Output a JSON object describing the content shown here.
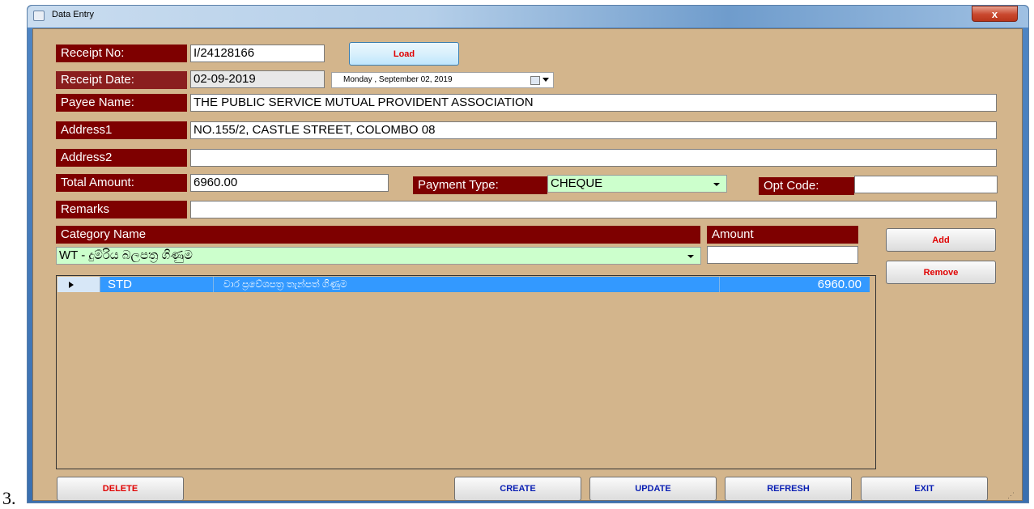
{
  "doc_marker": "3.",
  "window": {
    "title": "Data Entry",
    "close_label": "x"
  },
  "receipt_no": {
    "label": "Receipt No:",
    "value": "I/24128166",
    "load_label": "Load"
  },
  "receipt_date": {
    "label": "Receipt Date:",
    "value": "02-09-2019",
    "picker_value": "Monday   , September 02, 2019"
  },
  "payee_name": {
    "label": "Payee Name:",
    "value": "THE PUBLIC SERVICE MUTUAL PROVIDENT ASSOCIATION"
  },
  "address1": {
    "label": "Address1",
    "value": "NO.155/2, CASTLE STREET, COLOMBO 08"
  },
  "address2": {
    "label": "Address2",
    "value": ""
  },
  "total_amount": {
    "label": "Total Amount:",
    "value": "6960.00"
  },
  "payment_type": {
    "label": "Payment Type:",
    "value": "CHEQUE"
  },
  "opt_code": {
    "label": "Opt Code:",
    "value": ""
  },
  "remarks": {
    "label": "Remarks",
    "value": ""
  },
  "category": {
    "header": "Category Name",
    "value": "WT - දුම්රිය බලපත්‍ර ගිණුම"
  },
  "amount": {
    "header": "Amount",
    "value": ""
  },
  "side_buttons": {
    "add": "Add",
    "remove": "Remove"
  },
  "grid_rows": [
    {
      "code": "STD",
      "description": "වාර ප්‍රවේශපත්‍ර තැන්පත් ගිණුම",
      "amount": "6960.00"
    }
  ],
  "bottom_buttons": {
    "delete": "DELETE",
    "create": "CREATE",
    "update": "UPDATE",
    "refresh": "REFRESH",
    "exit": "EXIT"
  },
  "colors": {
    "label_bg": "#7e0000",
    "form_bg": "#d3b58c",
    "selection": "#3399ff",
    "green_field": "#ccffcc"
  }
}
